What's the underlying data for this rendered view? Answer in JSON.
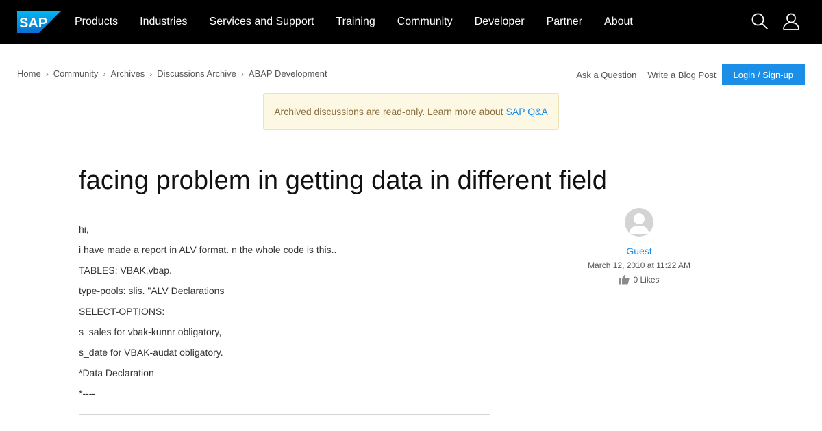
{
  "nav": {
    "logo_text": "SAP",
    "items": [
      "Products",
      "Industries",
      "Services and Support",
      "Training",
      "Community",
      "Developer",
      "Partner",
      "About"
    ]
  },
  "breadcrumb": [
    "Home",
    "Community",
    "Archives",
    "Discussions Archive",
    "ABAP Development"
  ],
  "actions": {
    "ask": "Ask a Question",
    "blog": "Write a Blog Post",
    "login": "Login / Sign-up"
  },
  "banner": {
    "text": "Archived discussions are read-only. Learn more about",
    "link": "SAP Q&A"
  },
  "title": "facing problem in getting data in different field",
  "body_lines": [
    "hi,",
    "i have made a report in ALV format. n the whole code is this..",
    "TABLES: VBAK,vbap.",
    "type-pools: slis. \"ALV Declarations",
    "SELECT-OPTIONS:",
    "s_sales for vbak-kunnr obligatory,",
    "s_date for VBAK-audat obligatory.",
    "*Data Declaration",
    "*----"
  ],
  "author": {
    "name": "Guest",
    "date": "March 12, 2010 at 11:22 AM",
    "likes": "0 Likes"
  },
  "colors": {
    "nav_bg": "#000000",
    "accent": "#1b8ee8",
    "banner_bg": "#fcf8e3",
    "banner_text": "#8a6d3b"
  },
  "icons": [
    "sap-logo",
    "search-icon",
    "user-icon",
    "avatar-icon",
    "thumbs-up-icon"
  ]
}
